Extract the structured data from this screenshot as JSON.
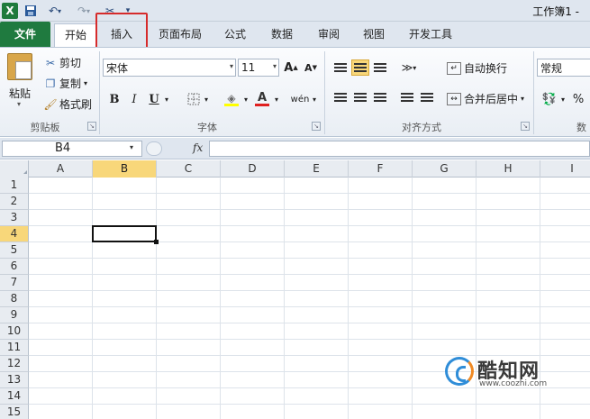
{
  "window": {
    "title": "工作簿1 -"
  },
  "quick_access": {
    "app_logo": "X",
    "more": "▾"
  },
  "tabs": [
    {
      "label": "文件"
    },
    {
      "label": "开始"
    },
    {
      "label": "插入"
    },
    {
      "label": "页面布局"
    },
    {
      "label": "公式"
    },
    {
      "label": "数据"
    },
    {
      "label": "审阅"
    },
    {
      "label": "视图"
    },
    {
      "label": "开发工具"
    }
  ],
  "ribbon": {
    "clipboard": {
      "paste": "粘贴",
      "cut": "剪切",
      "copy": "复制",
      "format_painter": "格式刷",
      "label": "剪贴板"
    },
    "font": {
      "name": "宋体",
      "size": "11",
      "bold": "B",
      "italic": "I",
      "underline": "U",
      "label": "字体",
      "grow": "A",
      "shrink": "A",
      "font_color_glyph": "A",
      "phonetic_glyph": "wén"
    },
    "alignment": {
      "wrap_text": "自动换行",
      "merge_center": "合并后居中",
      "label": "对齐方式"
    },
    "number": {
      "format": "常规",
      "percent": "%",
      "label_partial": "数"
    }
  },
  "formula_bar": {
    "name_box": "B4",
    "fx": "fx",
    "value": ""
  },
  "grid": {
    "columns": [
      "A",
      "B",
      "C",
      "D",
      "E",
      "F",
      "G",
      "H",
      "I"
    ],
    "rows": [
      "1",
      "2",
      "3",
      "4",
      "5",
      "6",
      "7",
      "8",
      "9",
      "10",
      "11",
      "12",
      "13",
      "14",
      "15"
    ],
    "selected_cell": "B4"
  },
  "watermark": {
    "name": "酷知网",
    "url": "www.coozhi.com"
  },
  "colors": {
    "file_tab": "#1f7a3f",
    "highlight_box": "#d62b2b",
    "active_header": "#f8d77a"
  }
}
